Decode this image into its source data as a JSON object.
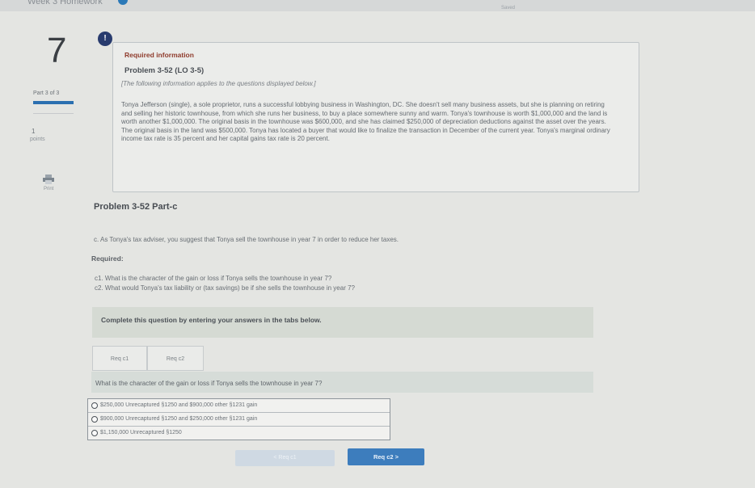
{
  "header": {
    "assignment": "Week 3 Homework",
    "saved": "Saved"
  },
  "sidebar": {
    "question_number": "7",
    "part": "Part 3 of 3",
    "points_value": "1",
    "points_label": "points",
    "print_label": "Print"
  },
  "info": {
    "alert_glyph": "!",
    "required_info": "Required information",
    "problem": "Problem 3-52 (LO 3-5)",
    "note": "[The following information applies to the questions displayed below.]",
    "paragraph": "Tonya Jefferson (single), a sole proprietor, runs a successful lobbying business in Washington, DC. She doesn't sell many business assets, but she is planning on retiring and selling her historic townhouse, from which she runs her business, to buy a place somewhere sunny and warm. Tonya's townhouse is worth $1,000,000 and the land is worth another $1,000,000. The original basis in the townhouse was $600,000, and she has claimed $250,000 of depreciation deductions against the asset over the years. The original basis in the land was $500,000. Tonya has located a buyer that would like to finalize the transaction in December of the current year. Tonya's marginal ordinary income tax rate is 35 percent and her capital gains tax rate is 20 percent."
  },
  "main": {
    "part_title": "Problem 3-52 Part-c",
    "c_text": "c. As Tonya's tax adviser, you suggest that Tonya sell the townhouse in year 7 in order to reduce her taxes.",
    "required": "Required:",
    "c1": "c1. What is the character of the gain or loss if Tonya sells the townhouse in year 7?",
    "c2": "c2. What would Tonya's tax liability or (tax savings) be if she sells the townhouse in year 7?",
    "complete": "Complete this question by entering your answers in the tabs below.",
    "tabs": [
      {
        "label": "Req c1"
      },
      {
        "label": "Req c2"
      }
    ],
    "question": "What is the character of the gain or loss if Tonya sells the townhouse in year 7?",
    "options": [
      {
        "label": "$250,000 Unrecaptured §1250 and $900,000 other §1231 gain"
      },
      {
        "label": "$900,000 Unrecaptured §1250 and $250,000 other §1231 gain"
      },
      {
        "label": "$1,150,000 Unrecaptured §1250"
      }
    ],
    "prev_label": "< Req c1",
    "next_label": "Req c2 >"
  },
  "colors": {
    "accent": "#3d7dbd",
    "required_red": "#8f3b2c",
    "alert_navy": "#283b6e"
  }
}
